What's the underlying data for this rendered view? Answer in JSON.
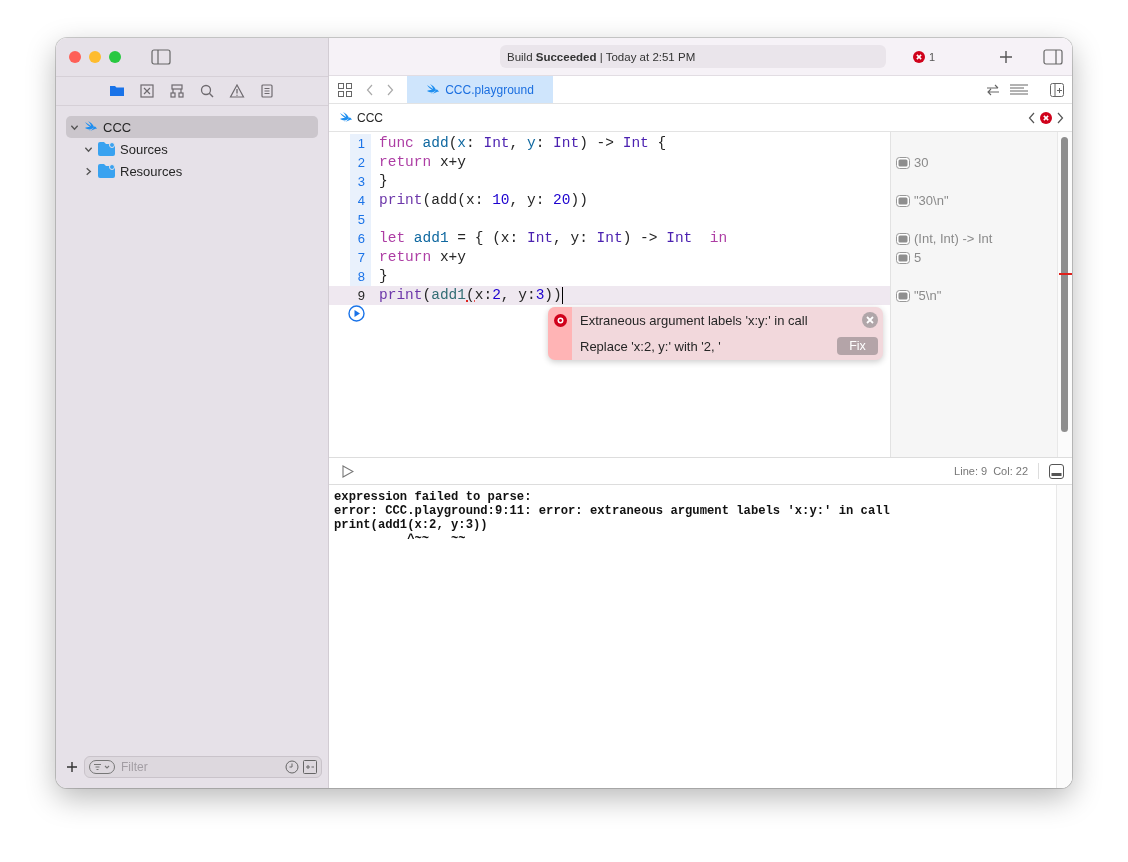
{
  "toolbar": {
    "build_label": "Build",
    "build_status": "Succeeded",
    "separator": "|",
    "build_time": "Today at 2:51 PM",
    "error_count": "1"
  },
  "navigator_tabs": [
    {
      "kind": "folder",
      "selected": true
    },
    {
      "kind": "xbox",
      "selected": false
    },
    {
      "kind": "hierarchy",
      "selected": false
    },
    {
      "kind": "search",
      "selected": false
    },
    {
      "kind": "warning",
      "selected": false
    },
    {
      "kind": "list",
      "selected": false
    }
  ],
  "tree": [
    {
      "name": "CCC",
      "kind": "project",
      "expanded": true,
      "selected": true,
      "children": [
        {
          "name": "Sources",
          "kind": "folder",
          "expanded": true,
          "selected": false
        },
        {
          "name": "Resources",
          "kind": "folder",
          "expanded": false,
          "selected": false
        }
      ]
    }
  ],
  "filter": {
    "placeholder": "Filter"
  },
  "editor_tabs": [
    {
      "label": "CCC.playground",
      "selected": true
    }
  ],
  "jump_bar": {
    "path": "CCC"
  },
  "code_lines": [
    {
      "number": "1",
      "executed": true,
      "current": false,
      "tokens": [
        {
          "kind": "kw",
          "text": "func "
        },
        {
          "kind": "decl",
          "text": "add"
        },
        {
          "kind": "plain",
          "text": "("
        },
        {
          "kind": "decl",
          "text": "x"
        },
        {
          "kind": "plain",
          "text": ": "
        },
        {
          "kind": "type",
          "text": "Int"
        },
        {
          "kind": "plain",
          "text": ", "
        },
        {
          "kind": "decl",
          "text": "y"
        },
        {
          "kind": "plain",
          "text": ": "
        },
        {
          "kind": "type",
          "text": "Int"
        },
        {
          "kind": "plain",
          "text": ") -> "
        },
        {
          "kind": "type",
          "text": "Int"
        },
        {
          "kind": "plain",
          "text": " {"
        }
      ]
    },
    {
      "number": "2",
      "executed": true,
      "current": false,
      "tokens": [
        {
          "kind": "kw",
          "text": "return"
        },
        {
          "kind": "plain",
          "text": " x+y"
        }
      ],
      "result": "30"
    },
    {
      "number": "3",
      "executed": true,
      "current": false,
      "tokens": [
        {
          "kind": "plain",
          "text": "}"
        }
      ]
    },
    {
      "number": "4",
      "executed": true,
      "current": false,
      "tokens": [
        {
          "kind": "call",
          "text": "print"
        },
        {
          "kind": "plain",
          "text": "(add(x: "
        },
        {
          "kind": "num",
          "text": "10"
        },
        {
          "kind": "plain",
          "text": ", y: "
        },
        {
          "kind": "num",
          "text": "20"
        },
        {
          "kind": "plain",
          "text": "))"
        }
      ],
      "result": "\"30\\n\""
    },
    {
      "number": "5",
      "executed": true,
      "current": false
    },
    {
      "number": "6",
      "executed": true,
      "current": false,
      "tokens": [
        {
          "kind": "kw",
          "text": "let "
        },
        {
          "kind": "decl",
          "text": "add1"
        },
        {
          "kind": "plain",
          "text": " = { (x: "
        },
        {
          "kind": "type",
          "text": "Int"
        },
        {
          "kind": "plain",
          "text": ", y: "
        },
        {
          "kind": "type",
          "text": "Int"
        },
        {
          "kind": "plain",
          "text": ") -> "
        },
        {
          "kind": "type",
          "text": "Int  "
        },
        {
          "kind": "kw",
          "text": "in"
        }
      ],
      "result": "(Int, Int) -> Int"
    },
    {
      "number": "7",
      "executed": true,
      "current": false,
      "tokens": [
        {
          "kind": "kw",
          "text": "return"
        },
        {
          "kind": "plain",
          "text": " x+y"
        }
      ],
      "result": "5"
    },
    {
      "number": "8",
      "executed": true,
      "current": false,
      "tokens": [
        {
          "kind": "plain",
          "text": "}"
        }
      ]
    },
    {
      "number": "9",
      "executed": false,
      "current": true,
      "tokens": [
        {
          "kind": "call",
          "text": "print"
        },
        {
          "kind": "plain",
          "text": "("
        },
        {
          "kind": "ident",
          "text": "add1"
        },
        {
          "kind": "err",
          "text": "("
        },
        {
          "kind": "plain",
          "text": "x:"
        },
        {
          "kind": "num",
          "text": "2"
        },
        {
          "kind": "plain",
          "text": ", y:"
        },
        {
          "kind": "num",
          "text": "3"
        },
        {
          "kind": "plain",
          "text": "))"
        }
      ],
      "result": "\"5\\n\""
    }
  ],
  "issue": {
    "message": "Extraneous argument labels 'x:y:' in call",
    "fix_text": "Replace 'x:2, y:' with '2, '",
    "fix_button": "Fix"
  },
  "status": {
    "line": "Line: 9",
    "col": "Col: 22"
  },
  "console": [
    "expression failed to parse:",
    "error: CCC.playground:9:11: error: extraneous argument labels 'x:y:' in call",
    "print(add1(x:2, y:3))",
    "          ^~~   ~~"
  ]
}
